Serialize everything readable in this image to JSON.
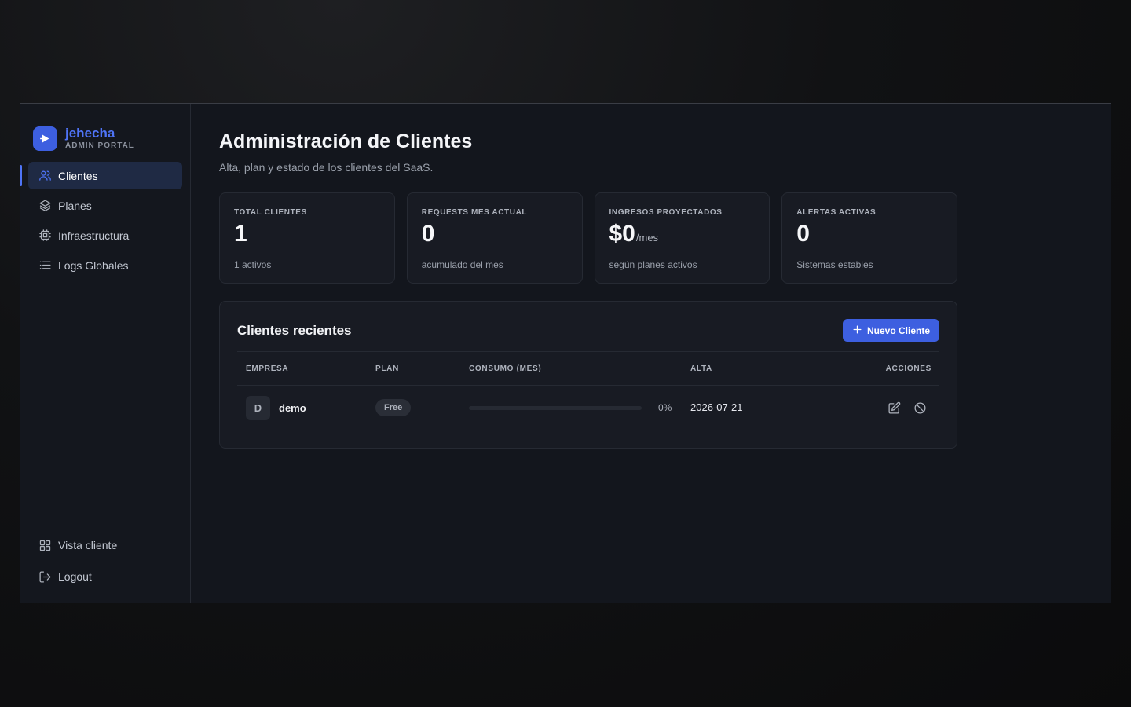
{
  "brand": {
    "name": "jehecha",
    "subtitle": "ADMIN PORTAL"
  },
  "nav": {
    "items": [
      {
        "label": "Clientes",
        "icon": "users-icon",
        "active": true
      },
      {
        "label": "Planes",
        "icon": "layers-icon"
      },
      {
        "label": "Infraestructura",
        "icon": "cpu-icon"
      },
      {
        "label": "Logs Globales",
        "icon": "list-icon"
      }
    ],
    "bottom": [
      {
        "label": "Vista cliente",
        "icon": "grid-icon"
      },
      {
        "label": "Logout",
        "icon": "logout-icon"
      }
    ]
  },
  "page": {
    "title": "Administración de Clientes",
    "subtitle": "Alta, plan y estado de los clientes del SaaS."
  },
  "stats": [
    {
      "label": "TOTAL CLIENTES",
      "value": "1",
      "suffix": "",
      "note": "1 activos"
    },
    {
      "label": "REQUESTS MES ACTUAL",
      "value": "0",
      "suffix": "",
      "note": "acumulado del mes"
    },
    {
      "label": "INGRESOS PROYECTADOS",
      "value": "$0",
      "suffix": "/mes",
      "note": "según planes activos"
    },
    {
      "label": "ALERTAS ACTIVAS",
      "value": "0",
      "suffix": "",
      "note": "Sistemas estables"
    }
  ],
  "recent": {
    "title": "Clientes recientes",
    "new_button": "Nuevo Cliente",
    "columns": [
      "EMPRESA",
      "PLAN",
      "CONSUMO (MES)",
      "ALTA",
      "ACCIONES"
    ],
    "rows": [
      {
        "initial": "D",
        "company": "demo",
        "plan": "Free",
        "usage_pct": 0,
        "usage_label": "0%",
        "created": "2026-07-21"
      }
    ]
  },
  "colors": {
    "accent": "#3d5fe0",
    "brand_text": "#4f74f7",
    "background": "#13161d"
  }
}
